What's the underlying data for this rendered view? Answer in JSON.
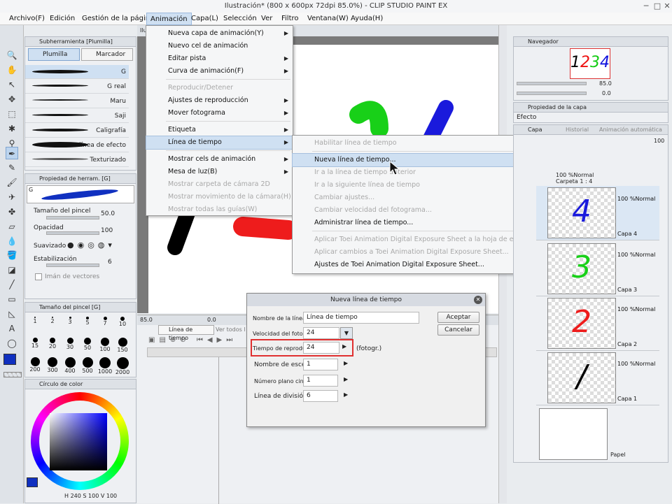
{
  "window": {
    "title": "Ilustración* (800 x 600px 72dpi 85.0%) - CLIP STUDIO PAINT EX"
  },
  "menubar": [
    "Archivo(F)",
    "Edición",
    "Gestión de la página",
    "Animación",
    "Capa(L)",
    "Selección",
    "Ver",
    "Filtro",
    "Ventana(W)",
    "Ayuda(H)"
  ],
  "subtool": {
    "header": "Subherramienta [Plumilla]",
    "tab1": "Plumilla",
    "tab2": "Marcador",
    "brushes": [
      "G",
      "G real",
      "Maru",
      "Saji",
      "Caligrafía",
      "Para línea de efecto",
      "Texturizado"
    ]
  },
  "toolprop": {
    "header": "Propiedad de herram. [G]",
    "brush": "G",
    "size_label": "Tamaño del pincel",
    "size_value": "50.0",
    "opacity_label": "Opacidad",
    "opacity_value": "100",
    "smooth_label": "Suavizado",
    "stab_label": "Estabilización",
    "stab_value": "6",
    "vector_label": "Imán de vectores"
  },
  "brushsize": {
    "header": "Tamaño del pincel [G]",
    "row1": [
      "1",
      "2",
      "3",
      "5",
      "7",
      "10"
    ],
    "row2": [
      "15",
      "20",
      "30",
      "50",
      "100",
      "150"
    ],
    "row3": [
      "200",
      "300",
      "400",
      "500",
      "1000",
      "2000"
    ]
  },
  "color": {
    "header": "Círculo de color",
    "readout": "240 S 100 V 100",
    "h_label": "H",
    "h": "240",
    "s": "100",
    "v": "100",
    "main": "#1030c0"
  },
  "canvas": {
    "tab": "Ilus",
    "zoom": "85.0",
    "zoom2": "0.0"
  },
  "timeline": {
    "tab": "Línea de tiempo",
    "tab2": "Ver todos l"
  },
  "animmenu": {
    "items": [
      {
        "label": "Nueva capa de animación(Y)",
        "arrow": true,
        "dis": false
      },
      {
        "label": "Nuevo cel de animación",
        "arrow": false,
        "dis": false
      },
      {
        "label": "Editar pista",
        "arrow": true,
        "dis": false
      },
      {
        "label": "Curva de animación(F)",
        "arrow": true,
        "dis": false
      },
      {
        "label": "Reproducir/Detener",
        "arrow": false,
        "dis": true
      },
      {
        "label": "Ajustes de reproducción",
        "arrow": true,
        "dis": false
      },
      {
        "label": "Mover fotograma",
        "arrow": true,
        "dis": false
      },
      {
        "label": "Etiqueta",
        "arrow": true,
        "dis": false
      },
      {
        "label": "Línea de tiempo",
        "arrow": true,
        "dis": false
      },
      {
        "label": "Mostrar cels de animación",
        "arrow": true,
        "dis": false
      },
      {
        "label": "Mesa de luz(B)",
        "arrow": true,
        "dis": false
      },
      {
        "label": "Mostrar carpeta de cámara 2D",
        "arrow": false,
        "dis": true
      },
      {
        "label": "Mostrar movimiento de la cámara(H)",
        "arrow": false,
        "dis": true
      },
      {
        "label": "Mostrar todas las guías(W)",
        "arrow": false,
        "dis": true
      }
    ]
  },
  "submenu": {
    "items": [
      {
        "label": "Habilitar línea de tiempo",
        "dis": true
      },
      {
        "label": "Nueva línea de tiempo...",
        "dis": false
      },
      {
        "label": "Ir a la línea de tiempo anterior",
        "dis": true
      },
      {
        "label": "Ir a la siguiente línea de tiempo",
        "dis": true
      },
      {
        "label": "Cambiar ajustes...",
        "dis": true
      },
      {
        "label": "Cambiar velocidad del fotograma...",
        "dis": true
      },
      {
        "label": "Administrar línea de tiempo...",
        "dis": false
      },
      {
        "label": "Aplicar Toei Animation Digital Exposure Sheet a la hoja de exposición actual...",
        "dis": true
      },
      {
        "label": "Aplicar cambios a Toei Animation Digital Exposure Sheet...",
        "dis": true
      },
      {
        "label": "Ajustes de Toei Animation Digital Exposure Sheet...",
        "dis": false
      }
    ]
  },
  "dialog": {
    "title": "Nueva línea de tiempo",
    "name_label": "Nombre de la línea de",
    "name_value": "Línea de tiempo",
    "fps_label": "Velocidad del fotogram",
    "fps_value": "24",
    "play_label": "Tiempo de reproducció",
    "play_value": "24",
    "play_unit": "(fotogr.)",
    "scene_label": "Nombre de escena",
    "scene_value": "1",
    "cut_label": "Número plano cinemato",
    "cut_value": "1",
    "div_label": "Línea de división",
    "div_value": "6",
    "ok": "Aceptar",
    "cancel": "Cancelar"
  },
  "navigator": {
    "tab": "Navegador",
    "zoom": "85.0",
    "rot": "0.0",
    "digits": [
      "1",
      "2",
      "3",
      "4"
    ]
  },
  "layerprop": {
    "tab": "Propiedad de la capa",
    "effect": "Efecto"
  },
  "layers": {
    "tabs": [
      "Capa",
      "Historial",
      "Animación automática"
    ],
    "opacity": "100",
    "folder": {
      "mode": "100 %Normal",
      "name": "Carpeta 1 : 4"
    },
    "items": [
      {
        "name": "Capa 4",
        "mode": "100 %Normal",
        "digit": "4",
        "color": "#1a1adc"
      },
      {
        "name": "Capa 3",
        "mode": "100 %Normal",
        "digit": "3",
        "color": "#18d018"
      },
      {
        "name": "Capa 2",
        "mode": "100 %Normal",
        "digit": "2",
        "color": "#ee1c1c"
      },
      {
        "name": "Capa 1",
        "mode": "100 %Normal",
        "digit": "/",
        "color": "#000000"
      }
    ],
    "paper": "Papel"
  }
}
